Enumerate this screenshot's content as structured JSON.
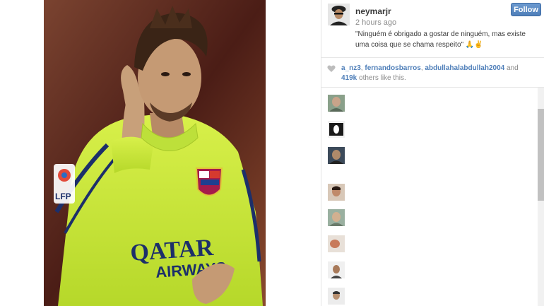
{
  "post": {
    "username": "neymarjr",
    "timestamp": "2 hours ago",
    "caption": "\"Ninguém é obrigado a gostar de ninguém, mas existe uma coisa que se chama respeito\" 🙏✌",
    "follow_label": "Follow"
  },
  "likes": {
    "user1": "a_nz3",
    "sep1": ", ",
    "user2": "fernandosbarros",
    "sep2": ", ",
    "user3": "abdullahalabdullah2004",
    "and": " and ",
    "count": "419k",
    "suffix": " others like this."
  },
  "photo": {
    "badge_lfp": "LFP",
    "sponsor_line1": "QATAR",
    "sponsor_line2": "AIRWAYS"
  },
  "colors": {
    "follow_button": "#4f7fb9",
    "link": "#4f7fb9",
    "jersey": "#c9e832"
  },
  "comments": [
    {
      "avatar": "comment-avatar-1"
    },
    {
      "avatar": "comment-avatar-2"
    },
    {
      "avatar": "comment-avatar-3"
    },
    {
      "avatar": "comment-avatar-4"
    },
    {
      "avatar": "comment-avatar-5"
    },
    {
      "avatar": "comment-avatar-6"
    },
    {
      "avatar": "comment-avatar-7"
    },
    {
      "avatar": "comment-avatar-8"
    }
  ]
}
